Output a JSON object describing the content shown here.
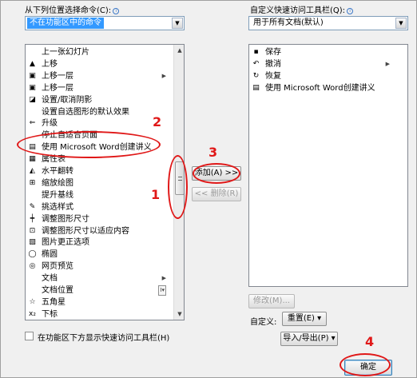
{
  "left_panel": {
    "label": "从下列位置选择命令(C):",
    "combo_value": "不在功能区中的命令",
    "items": [
      {
        "label": "上一张幻灯片",
        "icon": "slide-icon",
        "glyph": ""
      },
      {
        "label": "上移",
        "icon": "triangle-up-icon",
        "glyph": "▲"
      },
      {
        "label": "上移一层",
        "icon": "bring-forward-icon",
        "glyph": "▣",
        "submenu": true
      },
      {
        "label": "上移一层",
        "icon": "bring-forward-icon",
        "glyph": "▣"
      },
      {
        "label": "设置/取消阴影",
        "icon": "shadow-icon",
        "glyph": "◪"
      },
      {
        "label": "设置自选图形的默认效果",
        "icon": "blank-icon",
        "glyph": ""
      },
      {
        "label": "升级",
        "icon": "promote-arrow-icon",
        "glyph": "⇐"
      },
      {
        "label": "停止自适合页面",
        "icon": "blank-icon",
        "glyph": ""
      },
      {
        "label": "使用 Microsoft Word创建讲义",
        "icon": "word-handout-icon",
        "glyph": "▤"
      },
      {
        "label": "属性表",
        "icon": "property-sheet-icon",
        "glyph": "▦"
      },
      {
        "label": "水平翻转",
        "icon": "flip-horizontal-icon",
        "glyph": "◭"
      },
      {
        "label": "缩放绘图",
        "icon": "scale-drawing-icon",
        "glyph": "⊞"
      },
      {
        "label": "提升基线",
        "icon": "blank-icon",
        "glyph": ""
      },
      {
        "label": "挑选样式",
        "icon": "pick-style-icon",
        "glyph": "✎"
      },
      {
        "label": "调整图形尺寸",
        "icon": "resize-shape-icon",
        "glyph": "┿"
      },
      {
        "label": "调整图形尺寸以适应内容",
        "icon": "resize-fit-icon",
        "glyph": "⊡"
      },
      {
        "label": "图片更正选项",
        "icon": "picture-correct-icon",
        "glyph": "▧"
      },
      {
        "label": "椭圆",
        "icon": "ellipse-icon",
        "glyph": "◯"
      },
      {
        "label": "网页预览",
        "icon": "web-preview-icon",
        "glyph": "◎"
      },
      {
        "label": "文档",
        "icon": "blank-icon",
        "glyph": "",
        "submenu": true
      },
      {
        "label": "文档位置",
        "icon": "blank-icon",
        "glyph": "",
        "dropdown": "I▾"
      },
      {
        "label": "五角星",
        "icon": "star-icon",
        "glyph": "☆"
      },
      {
        "label": "下标",
        "icon": "subscript-icon",
        "glyph": "x₂"
      }
    ],
    "checkbox_label": "在功能区下方显示快速访问工具栏(H)"
  },
  "middle": {
    "add_button": "添加(A) >>",
    "remove_button": "<< 删除(R)"
  },
  "right_panel": {
    "label": "自定义快速访问工具栏(Q):",
    "combo_value": "用于所有文档(默认)",
    "items": [
      {
        "label": "保存",
        "icon": "save-icon",
        "glyph": "▪"
      },
      {
        "label": "撤消",
        "icon": "undo-icon",
        "glyph": "↶",
        "submenu": true
      },
      {
        "label": "恢复",
        "icon": "redo-icon",
        "glyph": "↻"
      },
      {
        "label": "使用 Microsoft Word创建讲义",
        "icon": "word-handout-icon",
        "glyph": "▤"
      }
    ],
    "modify_button": "修改(M)...",
    "customize_label": "自定义:",
    "reset_button": "重置(E) ▾",
    "import_export_button": "导入/导出(P) ▾"
  },
  "footer": {
    "ok_button": "确定"
  },
  "annotations": {
    "n1": "1",
    "n2": "2",
    "n3": "3",
    "n4": "4",
    "color": "#e01818"
  }
}
